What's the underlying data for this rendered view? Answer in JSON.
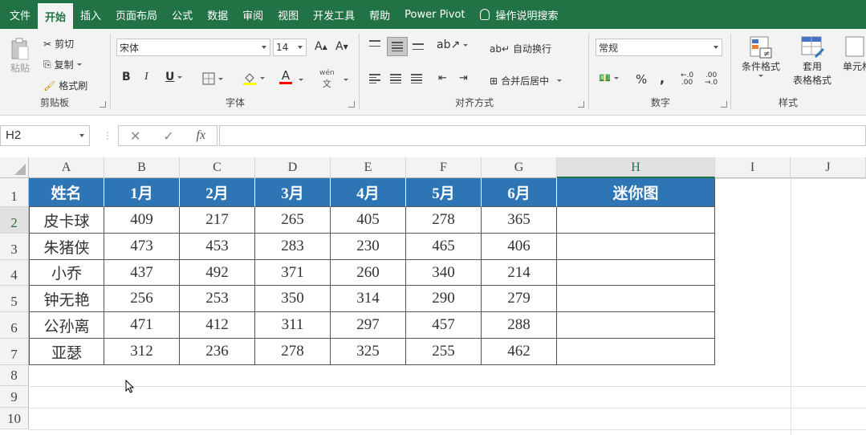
{
  "menu": {
    "items": [
      "文件",
      "开始",
      "插入",
      "页面布局",
      "公式",
      "数据",
      "审阅",
      "视图",
      "开发工具",
      "帮助",
      "Power Pivot"
    ],
    "active": "开始",
    "search": "操作说明搜索"
  },
  "ribbon": {
    "clipboard": {
      "label": "剪贴板",
      "paste": "粘贴",
      "cut": "剪切",
      "copy": "复制",
      "format_painter": "格式刷"
    },
    "font": {
      "label": "字体",
      "name": "宋体",
      "size": "14",
      "bold": "B",
      "italic": "I",
      "underline": "U",
      "grow": "A",
      "shrink": "A",
      "color": "A",
      "pinyin": "wén"
    },
    "alignment": {
      "label": "对齐方式",
      "wrap": "自动换行",
      "merge": "合并后居中"
    },
    "number": {
      "label": "数字",
      "format": "常规",
      "percent": "%",
      "comma": ",",
      "inc_decimal": "+0\n.00",
      "dec_decimal": ".00\n→.0"
    },
    "styles": {
      "label": "样式",
      "conditional": "条件格式",
      "table_format_1": "套用",
      "table_format_2": "表格格式",
      "cell_styles": "单元格"
    }
  },
  "formula_bar": {
    "name_box": "H2",
    "fx": "fx",
    "value": ""
  },
  "sheet": {
    "columns": [
      "A",
      "B",
      "C",
      "D",
      "E",
      "F",
      "G",
      "H",
      "I",
      "J"
    ],
    "rows": [
      "1",
      "2",
      "3",
      "4",
      "5",
      "6",
      "7",
      "8",
      "9",
      "10"
    ],
    "selected_column": "H",
    "selected_row": "2",
    "header": [
      "姓名",
      "1月",
      "2月",
      "3月",
      "4月",
      "5月",
      "6月",
      "迷你图"
    ],
    "data": [
      [
        "皮卡球",
        "409",
        "217",
        "265",
        "405",
        "278",
        "365",
        ""
      ],
      [
        "朱猪侠",
        "473",
        "453",
        "283",
        "230",
        "465",
        "406",
        ""
      ],
      [
        "小乔",
        "437",
        "492",
        "371",
        "260",
        "340",
        "214",
        ""
      ],
      [
        "钟无艳",
        "256",
        "253",
        "350",
        "314",
        "290",
        "279",
        ""
      ],
      [
        "公孙离",
        "471",
        "412",
        "311",
        "297",
        "457",
        "288",
        ""
      ],
      [
        "亚瑟",
        "312",
        "236",
        "278",
        "325",
        "255",
        "462",
        ""
      ]
    ],
    "header_color": "#2e75b6",
    "accent_color": "#217346"
  }
}
